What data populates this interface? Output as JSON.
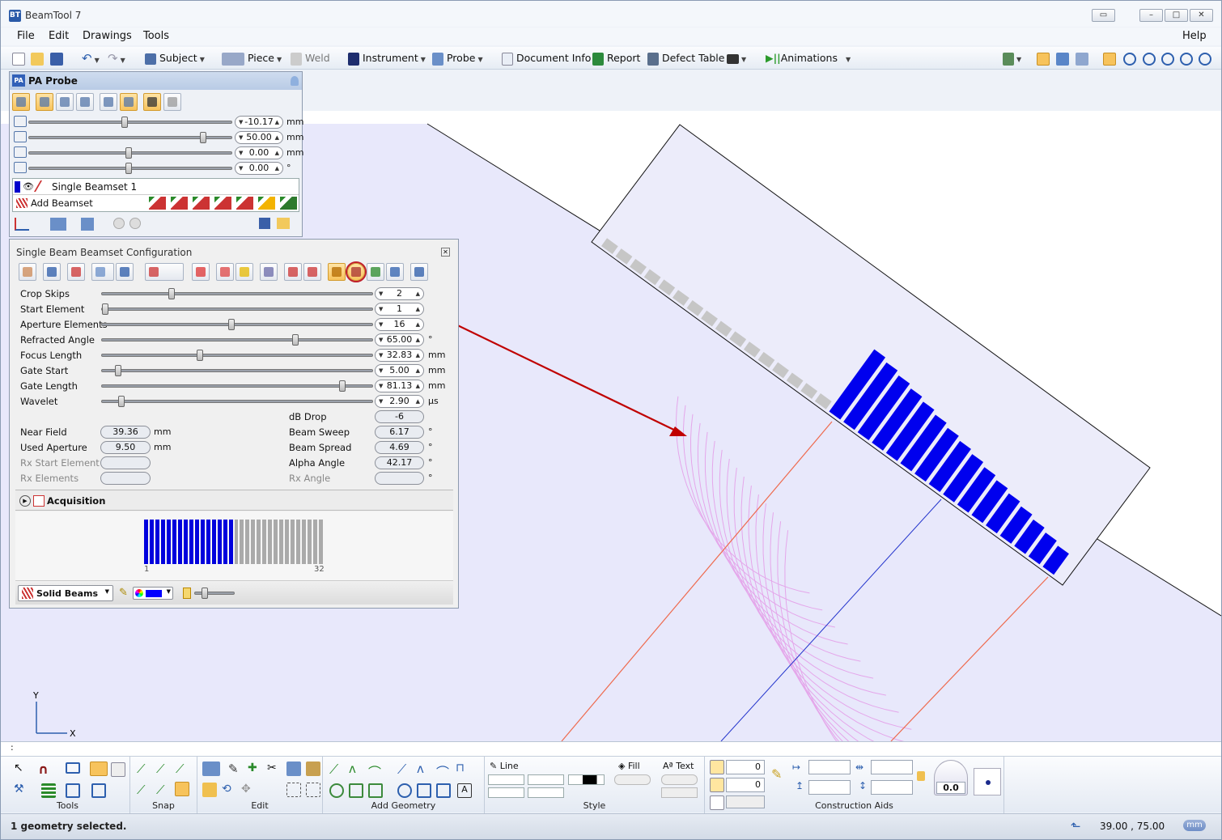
{
  "window": {
    "title": "BeamTool 7",
    "icon": "BT"
  },
  "menu": {
    "file": "File",
    "edit": "Edit",
    "drawings": "Drawings",
    "tools": "Tools",
    "help": "Help"
  },
  "toolbar": {
    "subject": "Subject",
    "piece": "Piece",
    "weld": "Weld",
    "instrument": "Instrument",
    "probe": "Probe",
    "document_info": "Document Info",
    "report": "Report",
    "defect_table": "Defect Table",
    "animations": "Animations"
  },
  "pa_probe": {
    "title": "PA Probe",
    "icon": "PA",
    "sliders": [
      {
        "icon": "probe-offset-icon",
        "value": "-10.17",
        "unit": "mm",
        "level": 0.47
      },
      {
        "icon": "wedge-height-icon",
        "value": "50.00",
        "unit": "mm",
        "level": 0.87
      },
      {
        "icon": "index-offset-icon",
        "value": "0.00",
        "unit": "mm",
        "level": 0.49
      },
      {
        "icon": "skew-angle-icon",
        "value": "0.00",
        "unit": "°",
        "level": 0.49
      }
    ],
    "beamsets": [
      {
        "name": "Single Beamset 1",
        "color": "#0000cc"
      }
    ],
    "add_beamset": "Add Beamset"
  },
  "config": {
    "title": "Single Beam Beamset Configuration",
    "params": [
      {
        "label": "Crop Skips",
        "value": "2",
        "unit": "",
        "level": 0.25
      },
      {
        "label": "Start Element",
        "value": "1",
        "unit": "",
        "level": 0.0
      },
      {
        "label": "Aperture Elements",
        "value": "16",
        "unit": "",
        "level": 0.48
      },
      {
        "label": "Refracted Angle",
        "value": "65.00",
        "unit": "°",
        "level": 0.72
      },
      {
        "label": "Focus Length",
        "value": "32.83",
        "unit": "mm",
        "level": 0.36
      },
      {
        "label": "Gate Start",
        "value": "5.00",
        "unit": "mm",
        "level": 0.05
      },
      {
        "label": "Gate Length",
        "value": "81.13",
        "unit": "mm",
        "level": 0.9
      },
      {
        "label": "Wavelet",
        "value": "2.90",
        "unit": "µs",
        "level": 0.06
      }
    ],
    "computed_left": [
      {
        "label": "Near Field",
        "value": "39.36",
        "unit": "mm",
        "disabled": false
      },
      {
        "label": "Used Aperture",
        "value": "9.50",
        "unit": "mm",
        "disabled": false
      },
      {
        "label": "Rx Start Element",
        "value": "",
        "unit": "",
        "disabled": true
      },
      {
        "label": "Rx Elements",
        "value": "",
        "unit": "",
        "disabled": true
      }
    ],
    "computed_right": [
      {
        "label": "dB Drop",
        "value": "-6",
        "unit": "",
        "disabled": false
      },
      {
        "label": "Beam Sweep",
        "value": "6.17",
        "unit": "°",
        "disabled": false
      },
      {
        "label": "Beam Spread",
        "value": "4.69",
        "unit": "°",
        "disabled": false
      },
      {
        "label": "Alpha Angle",
        "value": "42.17",
        "unit": "°",
        "disabled": false
      },
      {
        "label": "Rx Angle",
        "value": "",
        "unit": "°",
        "disabled": true
      }
    ],
    "acquisition": "Acquisition",
    "elements": {
      "total": 32,
      "active_start": 1,
      "active_count": 16,
      "first_label": "1",
      "last_label": "32",
      "active_color": "#0000dd",
      "inactive_color": "#aaaaaa"
    },
    "beam_style": "Solid Beams",
    "beam_color": "#0000ff"
  },
  "axes": {
    "y": "Y",
    "x": "X"
  },
  "command_line": ":",
  "ribbon": {
    "groups": [
      "Tools",
      "Snap",
      "Edit",
      "Add Geometry",
      "Style",
      "Construction Aids"
    ],
    "line": "Line",
    "fill": "Fill",
    "text": "Text",
    "field1": "0",
    "field2": "0",
    "dial_value": "0.0"
  },
  "status": {
    "message": "1 geometry selected.",
    "coords": "39.00 , 75.00",
    "units": "mm"
  },
  "colors": {
    "beam_focus": "#e49be8",
    "ray": "#ee6a4e",
    "center_ray": "#2233cc",
    "annotation_arrow": "#c00000",
    "canvas_fill": "#e8e8fb"
  }
}
